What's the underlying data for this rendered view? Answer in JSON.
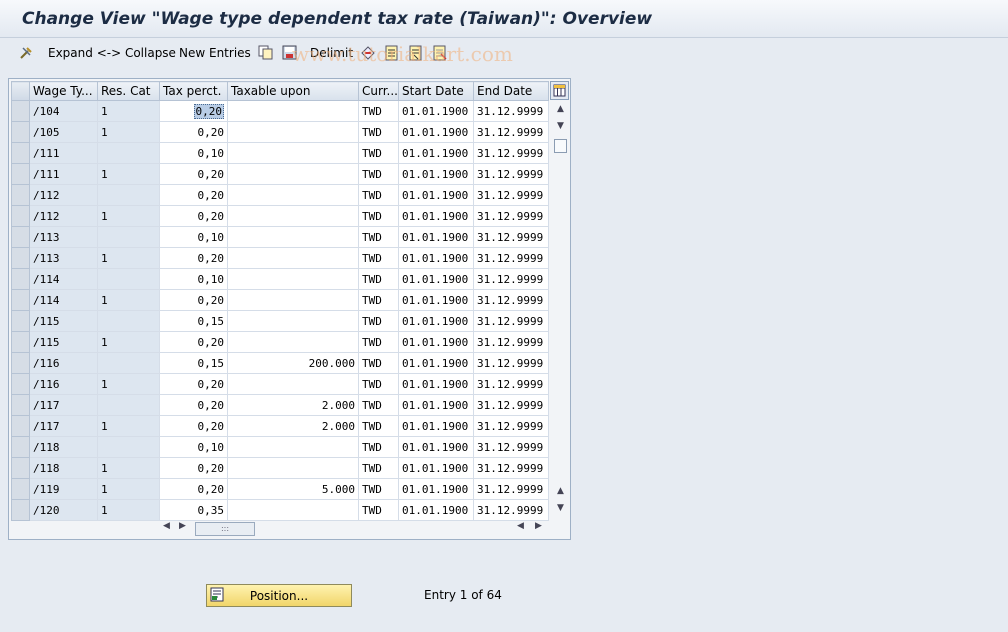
{
  "title": "Change View \"Wage type dependent tax rate (Taiwan)\": Overview",
  "watermark": "www.tutorialkart.com",
  "toolbar": {
    "expand_collapse": "Expand <-> Collapse",
    "new_entries": "New Entries",
    "delimit": "Delimit"
  },
  "table": {
    "columns": [
      "Wage Ty...",
      "Res. Cat",
      "Tax perct.",
      "Taxable upon",
      "Curr...",
      "Start Date",
      "End Date"
    ],
    "rows": [
      [
        "/104",
        "1",
        "0,20",
        "",
        "TWD",
        "01.01.1900",
        "31.12.9999"
      ],
      [
        "/105",
        "1",
        "0,20",
        "",
        "TWD",
        "01.01.1900",
        "31.12.9999"
      ],
      [
        "/111",
        "",
        "0,10",
        "",
        "TWD",
        "01.01.1900",
        "31.12.9999"
      ],
      [
        "/111",
        "1",
        "0,20",
        "",
        "TWD",
        "01.01.1900",
        "31.12.9999"
      ],
      [
        "/112",
        "",
        "0,20",
        "",
        "TWD",
        "01.01.1900",
        "31.12.9999"
      ],
      [
        "/112",
        "1",
        "0,20",
        "",
        "TWD",
        "01.01.1900",
        "31.12.9999"
      ],
      [
        "/113",
        "",
        "0,10",
        "",
        "TWD",
        "01.01.1900",
        "31.12.9999"
      ],
      [
        "/113",
        "1",
        "0,20",
        "",
        "TWD",
        "01.01.1900",
        "31.12.9999"
      ],
      [
        "/114",
        "",
        "0,10",
        "",
        "TWD",
        "01.01.1900",
        "31.12.9999"
      ],
      [
        "/114",
        "1",
        "0,20",
        "",
        "TWD",
        "01.01.1900",
        "31.12.9999"
      ],
      [
        "/115",
        "",
        "0,15",
        "",
        "TWD",
        "01.01.1900",
        "31.12.9999"
      ],
      [
        "/115",
        "1",
        "0,20",
        "",
        "TWD",
        "01.01.1900",
        "31.12.9999"
      ],
      [
        "/116",
        "",
        "0,15",
        "200.000",
        "TWD",
        "01.01.1900",
        "31.12.9999"
      ],
      [
        "/116",
        "1",
        "0,20",
        "",
        "TWD",
        "01.01.1900",
        "31.12.9999"
      ],
      [
        "/117",
        "",
        "0,20",
        "2.000",
        "TWD",
        "01.01.1900",
        "31.12.9999"
      ],
      [
        "/117",
        "1",
        "0,20",
        "2.000",
        "TWD",
        "01.01.1900",
        "31.12.9999"
      ],
      [
        "/118",
        "",
        "0,10",
        "",
        "TWD",
        "01.01.1900",
        "31.12.9999"
      ],
      [
        "/118",
        "1",
        "0,20",
        "",
        "TWD",
        "01.01.1900",
        "31.12.9999"
      ],
      [
        "/119",
        "1",
        "0,20",
        "5.000",
        "TWD",
        "01.01.1900",
        "31.12.9999"
      ],
      [
        "/120",
        "1",
        "0,35",
        "",
        "TWD",
        "01.01.1900",
        "31.12.9999"
      ]
    ]
  },
  "position_button": "Position...",
  "entry_info": "Entry 1 of 64",
  "icons": [
    "settings-wrench-icon",
    "copy-icon",
    "save-icon",
    "undo-icon",
    "select-all-icon",
    "select-block-icon",
    "deselect-all-icon",
    "table-config-icon",
    "position-icon"
  ],
  "colors": {
    "title": "#1c2c44",
    "key_column": "#dde6f0",
    "button_yellow": "#f1d56a"
  }
}
